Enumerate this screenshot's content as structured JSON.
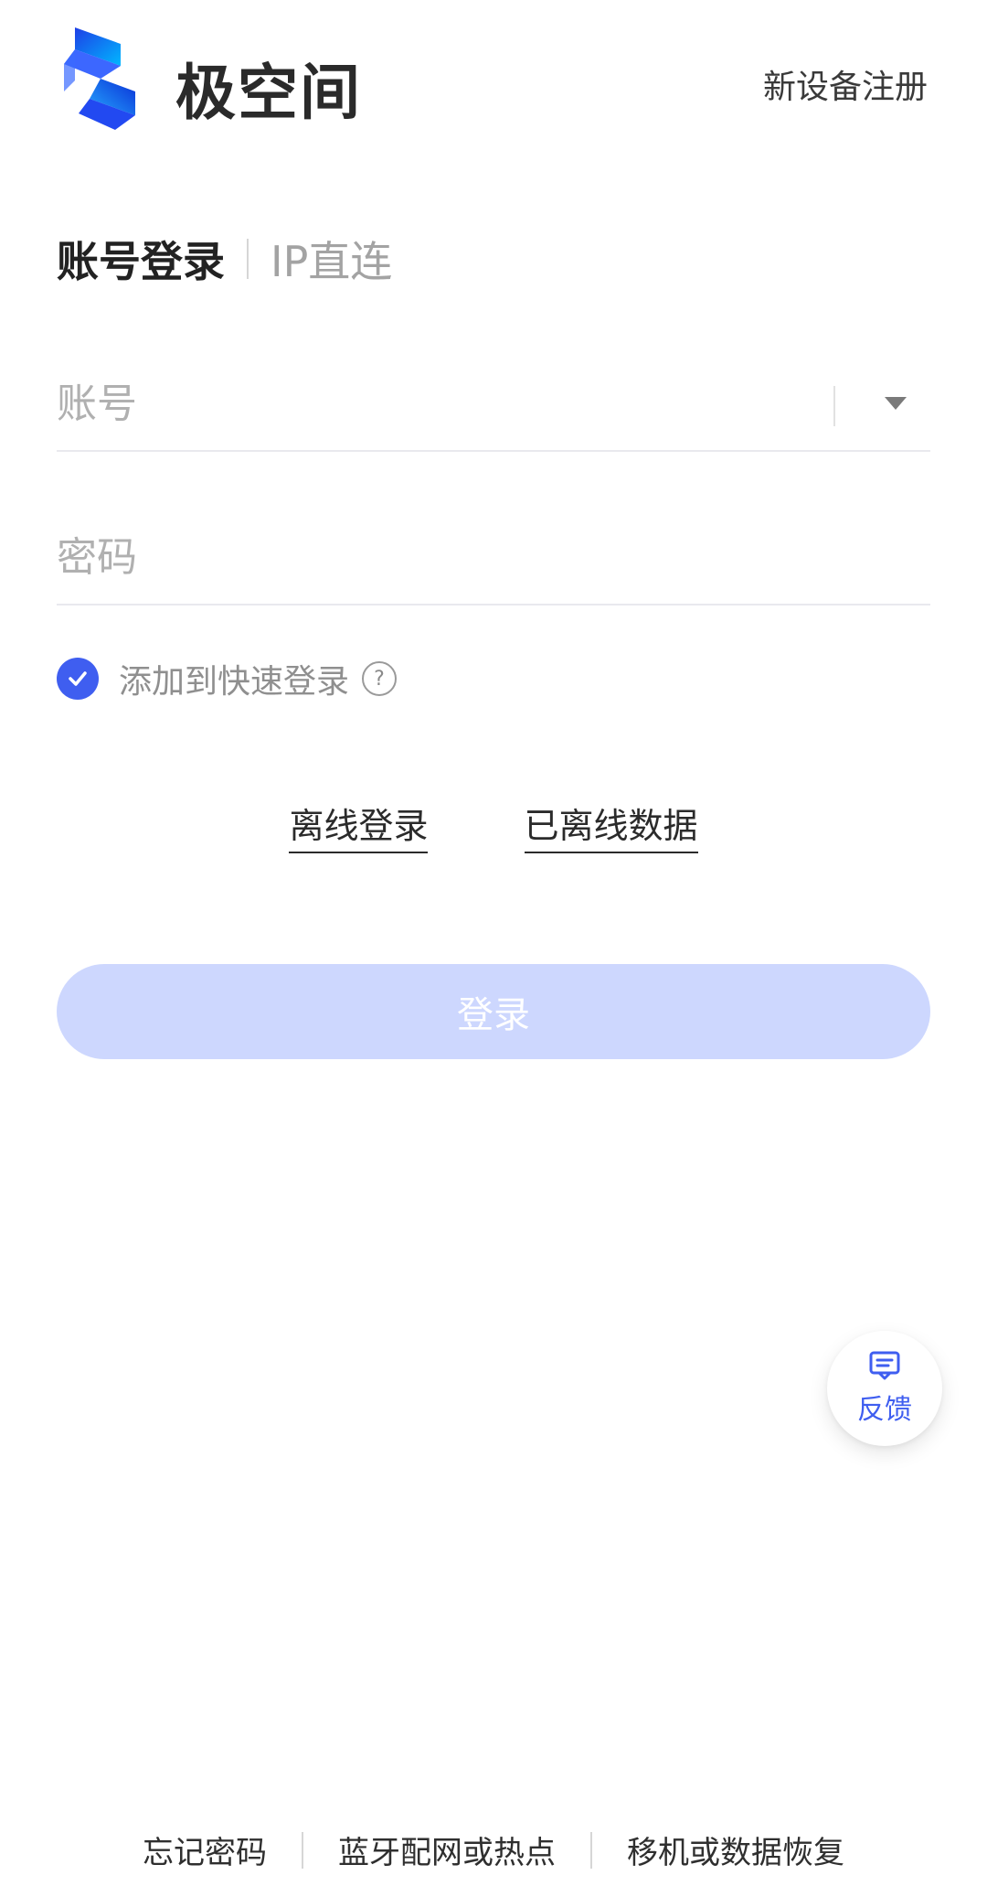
{
  "header": {
    "brand_title": "极空间",
    "register_label": "新设备注册",
    "logo_icon": "brand-logo-icon"
  },
  "tabs": [
    {
      "label": "账号登录",
      "active": true
    },
    {
      "label": "IP直连",
      "active": false
    }
  ],
  "form": {
    "account_placeholder": "账号",
    "password_placeholder": "密码",
    "quick_login_label": "添加到快速登录",
    "quick_login_checked": true,
    "help_icon": "question-circle-icon"
  },
  "links": {
    "offline_login": "离线登录",
    "offline_data": "已离线数据"
  },
  "login_button": {
    "label": "登录",
    "state": "disabled"
  },
  "feedback": {
    "label": "反馈",
    "icon": "message-square-icon"
  },
  "footer": {
    "items": [
      "忘记密码",
      "蓝牙配网或热点",
      "移机或数据恢复"
    ]
  },
  "colors": {
    "primary": "#3f5ef0",
    "primary_disabled": "#cdd7fe",
    "muted_text": "#a3a3a3"
  }
}
